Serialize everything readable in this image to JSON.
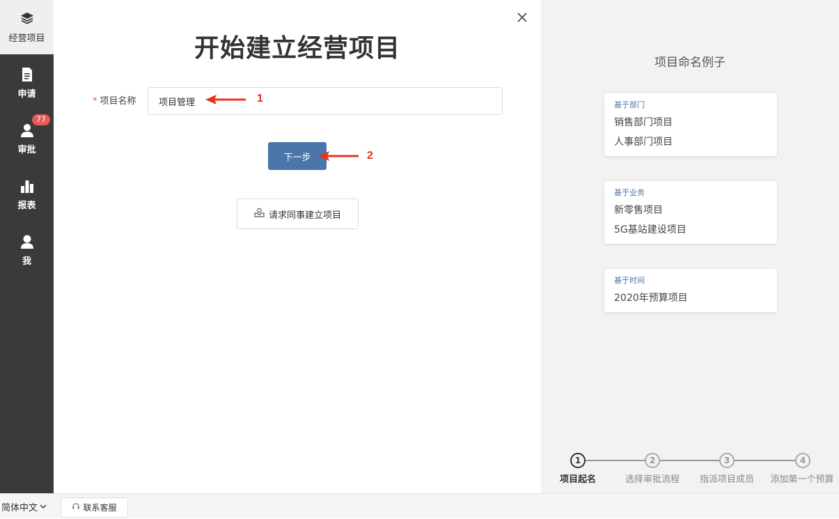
{
  "sidebar": {
    "items": [
      {
        "label": "经营项目",
        "icon": "layers-icon"
      },
      {
        "label": "申请",
        "icon": "document-icon"
      },
      {
        "label": "审批",
        "icon": "user-stamp-icon",
        "badge": "77"
      },
      {
        "label": "报表",
        "icon": "bar-chart-icon"
      },
      {
        "label": "我",
        "icon": "person-icon"
      }
    ]
  },
  "main": {
    "title": "开始建立经营项目",
    "form": {
      "required_mark": "*",
      "name_label": "项目名称",
      "name_value": "项目管理"
    },
    "next_button": "下一步",
    "request_button": "请求同事建立项目",
    "annotations": [
      "1",
      "2"
    ]
  },
  "examples": {
    "title": "项目命名例子",
    "cards": [
      {
        "category": "基于部门",
        "items": [
          "销售部门项目",
          "人事部门项目"
        ]
      },
      {
        "category": "基于业务",
        "items": [
          "新零售项目",
          "5G基站建设项目"
        ]
      },
      {
        "category": "基于时间",
        "items": [
          "2020年预算项目"
        ]
      }
    ]
  },
  "steps": [
    {
      "num": "1",
      "label": "项目起名",
      "active": true
    },
    {
      "num": "2",
      "label": "选择审批流程",
      "active": false
    },
    {
      "num": "3",
      "label": "指派项目成员",
      "active": false
    },
    {
      "num": "4",
      "label": "添加第一个预算",
      "active": false
    }
  ],
  "footer": {
    "language": "简体中文",
    "support": "联系客服"
  },
  "colors": {
    "sidebar_bg": "#3a3a3a",
    "accent": "#4a76ab",
    "badge": "#e9595b",
    "annotation": "#e8321c"
  }
}
